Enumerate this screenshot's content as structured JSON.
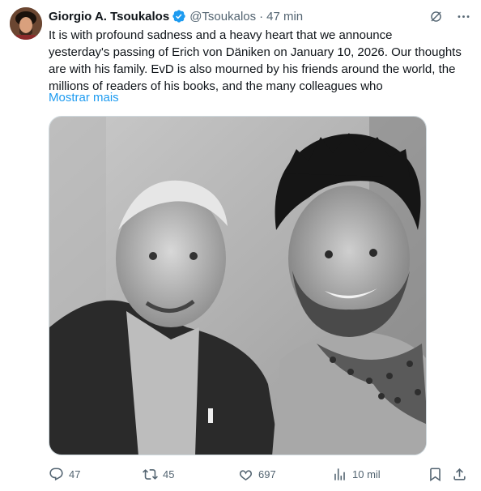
{
  "tweet": {
    "author_name": "Giorgio A. Tsoukalos",
    "handle": "@Tsoukalos",
    "separator": "·",
    "time": "47 min",
    "text_lines": [
      "It is with profound sadness and a heavy heart that we announce",
      "yesterday's passing of Erich von Däniken on January 10, 2026. Our thoughts",
      "are with his family. EvD is also mourned by his friends around the world, the",
      "millions of readers of his books, and the many colleagues who"
    ],
    "show_more": "Mostrar mais"
  },
  "actions": {
    "replies": "47",
    "reposts": "45",
    "likes": "697",
    "views": "10 mil"
  },
  "icons": {
    "verified": "verified-badge-icon",
    "grok": "grok-icon",
    "more": "more-icon",
    "reply": "reply-icon",
    "repost": "repost-icon",
    "like": "heart-icon",
    "views": "views-icon",
    "bookmark": "bookmark-icon",
    "share": "share-icon"
  },
  "colors": {
    "accent": "#1d9bf0",
    "text": "#0f1419",
    "secondary": "#536471"
  }
}
